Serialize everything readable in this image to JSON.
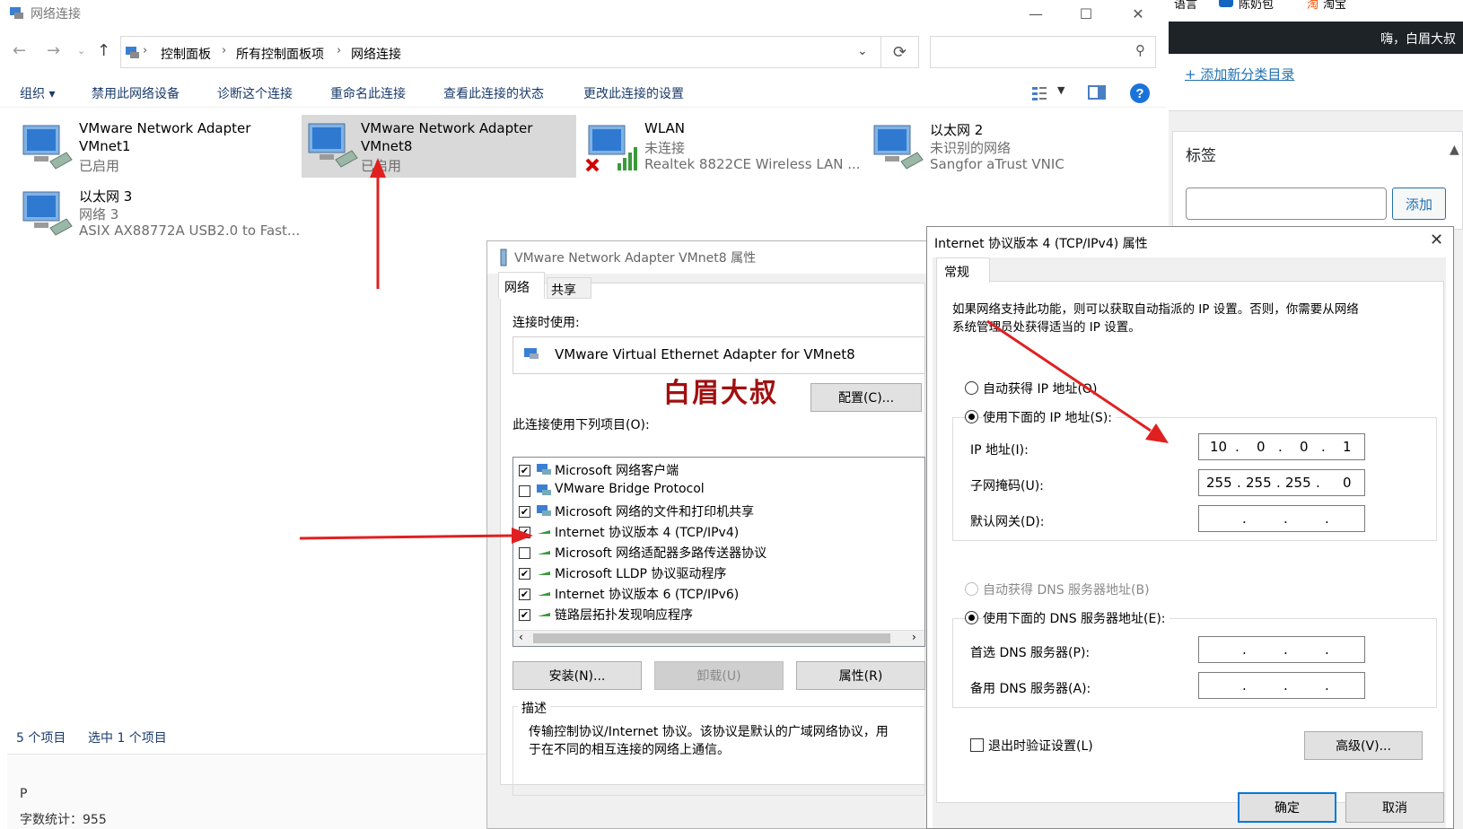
{
  "explorer": {
    "title": "网络连接",
    "breadcrumb": [
      "控制面板",
      "所有控制面板项",
      "网络连接"
    ],
    "toolbar": [
      "组织 ▾",
      "禁用此网络设备",
      "诊断这个连接",
      "重命名此连接",
      "查看此连接的状态",
      "更改此连接的设置"
    ],
    "items": [
      {
        "name": "VMware Network Adapter",
        "name2": "VMnet1",
        "status": "已启用",
        "detail": ""
      },
      {
        "name": "VMware Network Adapter",
        "name2": "VMnet8",
        "status": "已启用",
        "detail": ""
      },
      {
        "name": "WLAN",
        "name2": "",
        "status": "未连接",
        "detail": "Realtek 8822CE Wireless LAN ..."
      },
      {
        "name": "以太网 2",
        "name2": "",
        "status": "未识别的网络",
        "detail": "Sangfor aTrust VNIC"
      },
      {
        "name": "以太网 3",
        "name2": "",
        "status": "网络 3",
        "detail": "ASIX AX88772A USB2.0 to Fast..."
      }
    ],
    "status_count": "5 个项目",
    "status_selected": "选中 1 个项目",
    "editor_text": "P",
    "word_count": "字数统计：955"
  },
  "web": {
    "top_items": [
      "语言",
      "陈奶包",
      "淘宝"
    ],
    "greeting": "嗨，白眉大叔",
    "add_category": "+ 添加新分类目录",
    "tags_title": "标签",
    "add_button": "添加"
  },
  "props": {
    "title": "VMware Network Adapter VMnet8 属性",
    "tabs": [
      "网络",
      "共享"
    ],
    "connect_using_label": "连接时使用:",
    "adapter": "VMware Virtual Ethernet Adapter for VMnet8",
    "watermark": "白眉大叔",
    "configure_button": "配置(C)...",
    "items_label": "此连接使用下列项目(O):",
    "items": [
      {
        "checked": true,
        "label": "Microsoft 网络客户端"
      },
      {
        "checked": false,
        "label": "VMware Bridge Protocol"
      },
      {
        "checked": true,
        "label": "Microsoft 网络的文件和打印机共享"
      },
      {
        "checked": true,
        "label": "Internet 协议版本 4 (TCP/IPv4)"
      },
      {
        "checked": false,
        "label": "Microsoft 网络适配器多路传送器协议"
      },
      {
        "checked": true,
        "label": "Microsoft LLDP 协议驱动程序"
      },
      {
        "checked": true,
        "label": "Internet 协议版本 6 (TCP/IPv6)"
      },
      {
        "checked": true,
        "label": "链路层拓扑发现响应程序"
      }
    ],
    "install_button": "安装(N)...",
    "uninstall_button": "卸载(U)",
    "properties_button": "属性(R)",
    "desc_title": "描述",
    "desc_text1": "传输控制协议/Internet 协议。该协议是默认的广域网络协议，用",
    "desc_text2": "于在不同的相互连接的网络上通信。"
  },
  "ipv4": {
    "title": "Internet 协议版本 4 (TCP/IPv4) 属性",
    "tab": "常规",
    "intro1": "如果网络支持此功能，则可以获取自动指派的 IP 设置。否则，你需要从网络",
    "intro2": "系统管理员处获得适当的 IP 设置。",
    "auto_ip": "自动获得 IP 地址(O)",
    "manual_ip": "使用下面的 IP 地址(S):",
    "ip_label": "IP 地址(I):",
    "ip": [
      "10",
      "0",
      "0",
      "1"
    ],
    "mask_label": "子网掩码(U):",
    "mask": [
      "255",
      "255",
      "255",
      "0"
    ],
    "gateway_label": "默认网关(D):",
    "auto_dns": "自动获得 DNS 服务器地址(B)",
    "manual_dns": "使用下面的 DNS 服务器地址(E):",
    "dns1_label": "首选 DNS 服务器(P):",
    "dns2_label": "备用 DNS 服务器(A):",
    "validate": "退出时验证设置(L)",
    "advanced_button": "高级(V)...",
    "ok_button": "确定",
    "cancel_button": "取消"
  },
  "colors": {
    "accent": "#0078d7",
    "arrow": "#e02020",
    "watermark": "#a01010"
  }
}
